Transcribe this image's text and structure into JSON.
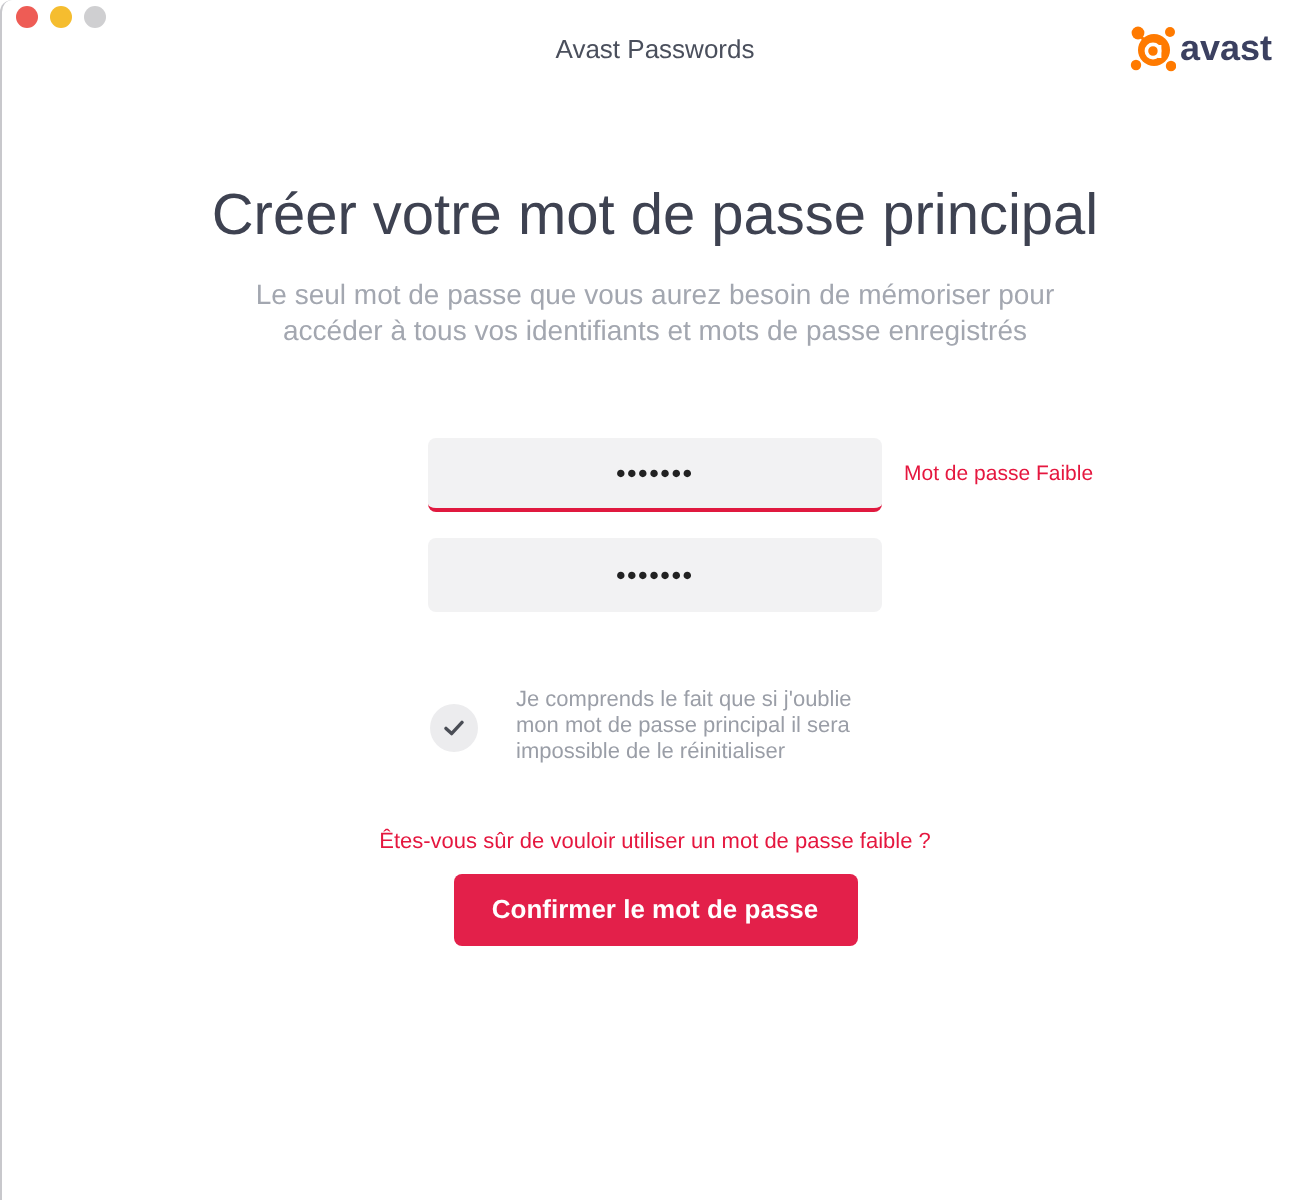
{
  "window": {
    "title": "Avast Passwords"
  },
  "logo": {
    "text": "avast"
  },
  "heading": "Créer votre mot de passe principal",
  "subtitle": "Le seul mot de passe que vous aurez besoin de mémoriser pour accéder à tous vos identifiants et mots de passe enregistrés",
  "fields": [
    {
      "value": "•••••••",
      "error": true
    },
    {
      "value": "•••••••",
      "error": false
    }
  ],
  "strength_label": "Mot de passe Faible",
  "acknowledgement": {
    "checked": true,
    "text": "Je comprends le fait que si j'oublie mon mot de passe principal il sera impossible de le réinitialiser"
  },
  "warning": "Êtes-vous sûr de vouloir utiliser un mot de passe faible ?",
  "confirm_button": "Confirmer le mot de passe"
}
